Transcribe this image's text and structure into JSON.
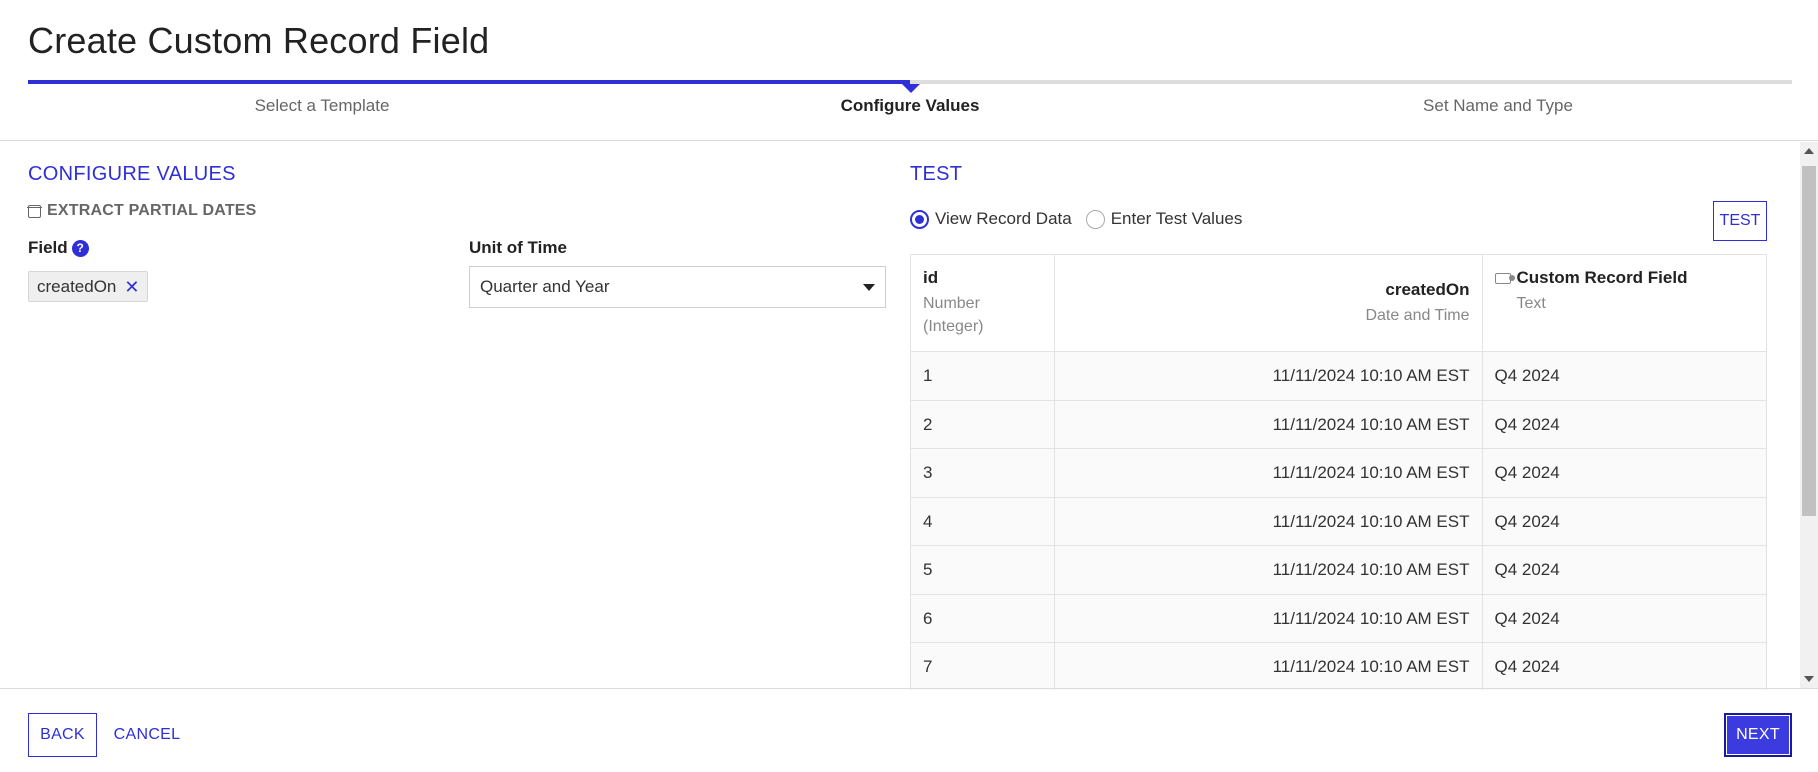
{
  "page": {
    "title": "Create Custom Record Field"
  },
  "stepper": {
    "steps": [
      {
        "label": "Select a Template",
        "state": "done"
      },
      {
        "label": "Configure Values",
        "state": "active"
      },
      {
        "label": "Set Name and Type",
        "state": "pending"
      }
    ],
    "accent_color": "#2f2fd8"
  },
  "configure": {
    "title": "CONFIGURE VALUES",
    "subhead": "EXTRACT PARTIAL DATES",
    "field_label": "Field",
    "field_value": "createdOn",
    "unit_label": "Unit of Time",
    "unit_value": "Quarter and Year"
  },
  "test": {
    "title": "TEST",
    "radio_view": "View Record Data",
    "radio_enter": "Enter Test Values",
    "selected": "View Record Data",
    "button": "TEST",
    "columns": [
      {
        "name": "id",
        "type_line1": "Number",
        "type_line2": "(Integer)"
      },
      {
        "name": "createdOn",
        "type_line1": "Date and Time"
      },
      {
        "name": "Custom Record Field",
        "type_line1": "Text"
      }
    ],
    "rows": [
      {
        "id": "1",
        "createdOn": "11/11/2024 10:10 AM EST",
        "custom": "Q4 2024"
      },
      {
        "id": "2",
        "createdOn": "11/11/2024 10:10 AM EST",
        "custom": "Q4 2024"
      },
      {
        "id": "3",
        "createdOn": "11/11/2024 10:10 AM EST",
        "custom": "Q4 2024"
      },
      {
        "id": "4",
        "createdOn": "11/11/2024 10:10 AM EST",
        "custom": "Q4 2024"
      },
      {
        "id": "5",
        "createdOn": "11/11/2024 10:10 AM EST",
        "custom": "Q4 2024"
      },
      {
        "id": "6",
        "createdOn": "11/11/2024 10:10 AM EST",
        "custom": "Q4 2024"
      },
      {
        "id": "7",
        "createdOn": "11/11/2024 10:10 AM EST",
        "custom": "Q4 2024"
      }
    ]
  },
  "footer": {
    "back": "BACK",
    "cancel": "CANCEL",
    "next": "NEXT"
  }
}
